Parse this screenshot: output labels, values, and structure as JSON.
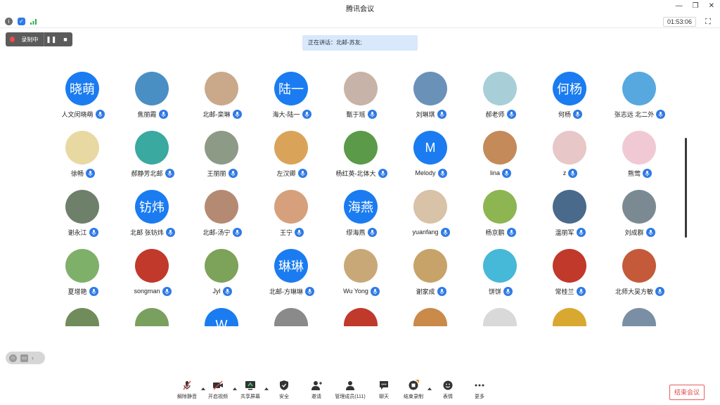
{
  "window": {
    "title": "腾讯会议"
  },
  "status": {
    "timer": "01:53:06"
  },
  "recording": {
    "label": "录制中"
  },
  "speaking": {
    "text": "正在讲话：北邮-苏友;"
  },
  "participants": [
    {
      "name": "人文闵晓萌",
      "avatar_text": "晓萌",
      "color": "#1a7cf0"
    },
    {
      "name": "焦丽霞",
      "avatar_text": "",
      "color": "#4a8fc4"
    },
    {
      "name": "北邮-栾琳",
      "avatar_text": "",
      "color": "#c9a98a"
    },
    {
      "name": "海大-陆一",
      "avatar_text": "陆一",
      "color": "#1a7cf0"
    },
    {
      "name": "甄于瑶",
      "avatar_text": "",
      "color": "#c8b3a9"
    },
    {
      "name": "刘琳琪",
      "avatar_text": "",
      "color": "#6a91b8"
    },
    {
      "name": "郝老师",
      "avatar_text": "",
      "color": "#a8cfd8"
    },
    {
      "name": "何杨",
      "avatar_text": "何杨",
      "color": "#1a7cf0"
    },
    {
      "name": "张志远 北二外",
      "avatar_text": "",
      "color": "#58a8e0"
    },
    {
      "name": "徐畅",
      "avatar_text": "",
      "color": "#e8d9a3"
    },
    {
      "name": "郝静芳北邮",
      "avatar_text": "",
      "color": "#3aa9a0"
    },
    {
      "name": "王丽丽",
      "avatar_text": "",
      "color": "#8c9a86"
    },
    {
      "name": "左汉卿",
      "avatar_text": "",
      "color": "#d9a45a"
    },
    {
      "name": "杨红英-北体大",
      "avatar_text": "",
      "color": "#5a9a48"
    },
    {
      "name": "Melody",
      "avatar_text": "M",
      "color": "#1a7cf0"
    },
    {
      "name": "lina",
      "avatar_text": "",
      "color": "#c48a5a"
    },
    {
      "name": "z",
      "avatar_text": "",
      "color": "#e7c7c7"
    },
    {
      "name": "熊莺",
      "avatar_text": "",
      "color": "#f1c9d5"
    },
    {
      "name": "谢永江",
      "avatar_text": "",
      "color": "#6e7f6a"
    },
    {
      "name": "北邮 张钫炜",
      "avatar_text": "钫炜",
      "color": "#1a7cf0"
    },
    {
      "name": "北邮-汤宁",
      "avatar_text": "",
      "color": "#b58a73"
    },
    {
      "name": "王宁",
      "avatar_text": "",
      "color": "#d6a07c"
    },
    {
      "name": "缪海燕",
      "avatar_text": "海燕",
      "color": "#1a7cf0"
    },
    {
      "name": "yuanfang",
      "avatar_text": "",
      "color": "#d8c2a8"
    },
    {
      "name": "杨京鹏",
      "avatar_text": "",
      "color": "#8db552"
    },
    {
      "name": "温丽军",
      "avatar_text": "",
      "color": "#4a6a8c"
    },
    {
      "name": "刘成群",
      "avatar_text": "",
      "color": "#7b8a92"
    },
    {
      "name": "夏增艳",
      "avatar_text": "",
      "color": "#7fb06a"
    },
    {
      "name": "songman",
      "avatar_text": "",
      "color": "#c0392b"
    },
    {
      "name": "Jyl",
      "avatar_text": "",
      "color": "#7da25a"
    },
    {
      "name": "北邮-方琳琳",
      "avatar_text": "琳琳",
      "color": "#1a7cf0"
    },
    {
      "name": "Wu Yong",
      "avatar_text": "",
      "color": "#c9a878"
    },
    {
      "name": "谢家成",
      "avatar_text": "",
      "color": "#c7a36a"
    },
    {
      "name": "饼饼",
      "avatar_text": "",
      "color": "#46b8d8"
    },
    {
      "name": "常桂兰",
      "avatar_text": "",
      "color": "#c0392b"
    },
    {
      "name": "北师大吴方敏",
      "avatar_text": "",
      "color": "#c45a3a"
    },
    {
      "name": "",
      "avatar_text": "",
      "color": "#6f8c5a"
    },
    {
      "name": "",
      "avatar_text": "",
      "color": "#7aa060"
    },
    {
      "name": "",
      "avatar_text": "W",
      "color": "#1a7cf0"
    },
    {
      "name": "",
      "avatar_text": "",
      "color": "#8a8a8a"
    },
    {
      "name": "",
      "avatar_text": "",
      "color": "#c0392b"
    },
    {
      "name": "",
      "avatar_text": "",
      "color": "#c98a4a"
    },
    {
      "name": "",
      "avatar_text": "",
      "color": "#d9d9d9"
    },
    {
      "name": "",
      "avatar_text": "",
      "color": "#d8a830"
    },
    {
      "name": "",
      "avatar_text": "",
      "color": "#7a8fa5"
    }
  ],
  "toolbar": {
    "unmute": "解除静音",
    "start_video": "开启视频",
    "share_screen": "共享屏幕",
    "security": "安全",
    "invite": "邀请",
    "manage_members": "管理成员(111)",
    "chat": "聊天",
    "end_recording": "结束录制",
    "reactions": "表情",
    "more": "更多",
    "end_meeting": "结束会议"
  }
}
